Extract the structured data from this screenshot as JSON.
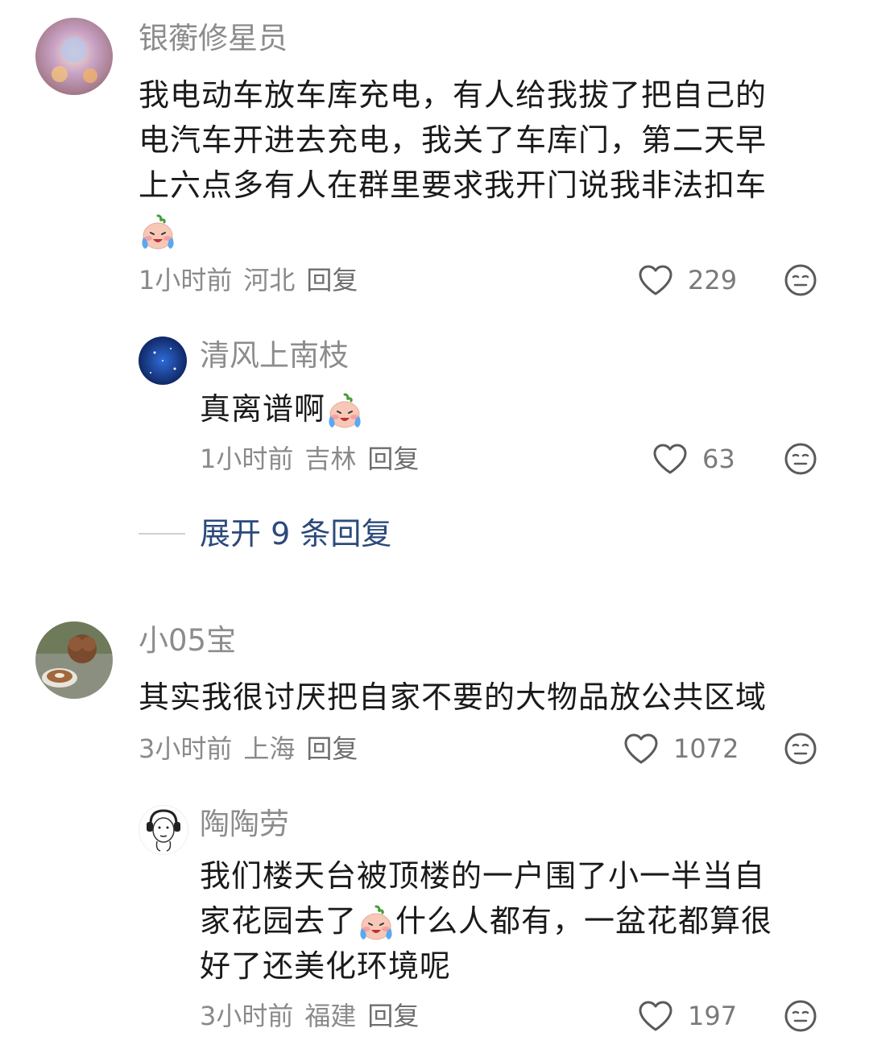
{
  "comments": [
    {
      "username": "银蘅修星员",
      "text_lines": [
        "我电动车放车库充电，有人给我拔了把自己的",
        "电汽车开进去充电，我关了车库门，第二天早",
        "上六点多有人在群里要求我开门说我非法扣车"
      ],
      "emoji": "crying-face-emoji",
      "time": "1小时前",
      "location": "河北",
      "reply_label": "回复",
      "likes": "229"
    },
    {
      "username": "清风上南枝",
      "text": "真离谱啊",
      "emoji": "crying-face-emoji",
      "time": "1小时前",
      "location": "吉林",
      "reply_label": "回复",
      "likes": "63"
    },
    {
      "username": "小05宝",
      "text": "其实我很讨厌把自家不要的大物品放公共区域",
      "time": "3小时前",
      "location": "上海",
      "reply_label": "回复",
      "likes": "1072"
    },
    {
      "username": "陶陶劳",
      "text_line1": "我们楼天台被顶楼的一户围了小一半当自",
      "text_line2a": "家花园去了",
      "text_line2b": "什么人都有，一盆花都算很",
      "text_line3": "好了还美化环境呢",
      "emoji": "crying-face-emoji",
      "time": "3小时前",
      "location": "福建",
      "reply_label": "回复",
      "likes": "197"
    }
  ],
  "expand_replies": "展开 9 条回复",
  "colors": {
    "username": "#8c8c8c",
    "text": "#1a1a1a",
    "meta": "#8a8a8a",
    "link": "#2b4a7a"
  }
}
